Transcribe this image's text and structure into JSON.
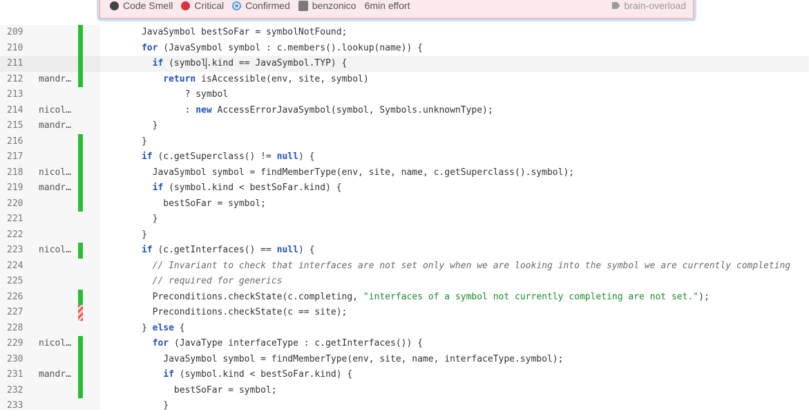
{
  "issue": {
    "type": "Code Smell",
    "severity": "Critical",
    "status": "Confirmed",
    "assignee": "benzonico",
    "effort": "6min effort",
    "tag": "brain-overload"
  },
  "lines": [
    {
      "num": "209",
      "author": "",
      "coverage": "covered",
      "code": [
        {
          "t": "      JavaSymbol bestSoFar = symbolNotFound;"
        }
      ]
    },
    {
      "num": "210",
      "author": "",
      "coverage": "covered",
      "code": [
        {
          "t": "      "
        },
        {
          "t": "for",
          "c": "kw"
        },
        {
          "t": " (JavaSymbol symbol : c.members().lookup(name)) {"
        }
      ]
    },
    {
      "num": "211",
      "author": "",
      "coverage": "covered",
      "highlight": true,
      "code": [
        {
          "t": "        "
        },
        {
          "t": "if",
          "c": "kw"
        },
        {
          "t": " (symbol.kind == JavaSymbol.TYP) {"
        }
      ]
    },
    {
      "num": "212",
      "author": "mandr…",
      "coverage": "covered",
      "code": [
        {
          "t": "          "
        },
        {
          "t": "return",
          "c": "kw"
        },
        {
          "t": " isAccessible(env, site, symbol)"
        }
      ]
    },
    {
      "num": "213",
      "author": "",
      "coverage": "",
      "code": [
        {
          "t": "              ? symbol"
        }
      ]
    },
    {
      "num": "214",
      "author": "nicol…",
      "coverage": "",
      "code": [
        {
          "t": "              : "
        },
        {
          "t": "new",
          "c": "kw"
        },
        {
          "t": " AccessErrorJavaSymbol(symbol, Symbols.unknownType);"
        }
      ]
    },
    {
      "num": "215",
      "author": "mandr…",
      "coverage": "",
      "code": [
        {
          "t": "        }"
        }
      ]
    },
    {
      "num": "216",
      "author": "",
      "coverage": "covered",
      "code": [
        {
          "t": "      }"
        }
      ]
    },
    {
      "num": "217",
      "author": "",
      "coverage": "covered",
      "code": [
        {
          "t": "      "
        },
        {
          "t": "if",
          "c": "kw"
        },
        {
          "t": " (c.getSuperclass() != "
        },
        {
          "t": "null",
          "c": "kw"
        },
        {
          "t": ") {"
        }
      ]
    },
    {
      "num": "218",
      "author": "nicol…",
      "coverage": "covered",
      "code": [
        {
          "t": "        JavaSymbol symbol = findMemberType(env, site, name, c.getSuperclass().symbol);"
        }
      ]
    },
    {
      "num": "219",
      "author": "mandr…",
      "coverage": "covered",
      "code": [
        {
          "t": "        "
        },
        {
          "t": "if",
          "c": "kw"
        },
        {
          "t": " (symbol.kind < bestSoFar.kind) {"
        }
      ]
    },
    {
      "num": "220",
      "author": "",
      "coverage": "covered",
      "code": [
        {
          "t": "          bestSoFar = symbol;"
        }
      ]
    },
    {
      "num": "221",
      "author": "",
      "coverage": "",
      "code": [
        {
          "t": "        }"
        }
      ]
    },
    {
      "num": "222",
      "author": "",
      "coverage": "",
      "code": [
        {
          "t": "      }"
        }
      ]
    },
    {
      "num": "223",
      "author": "nicol…",
      "coverage": "covered",
      "code": [
        {
          "t": "      "
        },
        {
          "t": "if",
          "c": "kw"
        },
        {
          "t": " (c.getInterfaces() == "
        },
        {
          "t": "null",
          "c": "kw"
        },
        {
          "t": ") {"
        }
      ]
    },
    {
      "num": "224",
      "author": "",
      "coverage": "",
      "code": [
        {
          "t": "        "
        },
        {
          "t": "// Invariant to check that interfaces are not set only when we are looking into the symbol we are currently completing",
          "c": "cm"
        }
      ]
    },
    {
      "num": "225",
      "author": "",
      "coverage": "",
      "code": [
        {
          "t": "        "
        },
        {
          "t": "// required for generics",
          "c": "cm"
        }
      ]
    },
    {
      "num": "226",
      "author": "",
      "coverage": "covered",
      "code": [
        {
          "t": "        Preconditions.checkState(c.completing, "
        },
        {
          "t": "\"interfaces of a symbol not currently completing are not set.\"",
          "c": "str"
        },
        {
          "t": ");"
        }
      ]
    },
    {
      "num": "227",
      "author": "",
      "coverage": "uncovered",
      "code": [
        {
          "t": "        Preconditions.checkState(c == site);"
        }
      ]
    },
    {
      "num": "228",
      "author": "",
      "coverage": "",
      "code": [
        {
          "t": "      } "
        },
        {
          "t": "else",
          "c": "kw"
        },
        {
          "t": " {"
        }
      ]
    },
    {
      "num": "229",
      "author": "nicol…",
      "coverage": "covered",
      "code": [
        {
          "t": "        "
        },
        {
          "t": "for",
          "c": "kw"
        },
        {
          "t": " (JavaType interfaceType : c.getInterfaces()) {"
        }
      ]
    },
    {
      "num": "230",
      "author": "",
      "coverage": "covered",
      "code": [
        {
          "t": "          JavaSymbol symbol = findMemberType(env, site, name, interfaceType.symbol);"
        }
      ]
    },
    {
      "num": "231",
      "author": "mandr…",
      "coverage": "covered",
      "code": [
        {
          "t": "          "
        },
        {
          "t": "if",
          "c": "kw"
        },
        {
          "t": " (symbol.kind < bestSoFar.kind) {"
        }
      ]
    },
    {
      "num": "232",
      "author": "",
      "coverage": "covered",
      "code": [
        {
          "t": "            bestSoFar = symbol;"
        }
      ]
    },
    {
      "num": "233",
      "author": "",
      "coverage": "",
      "code": [
        {
          "t": "          }"
        }
      ]
    }
  ]
}
